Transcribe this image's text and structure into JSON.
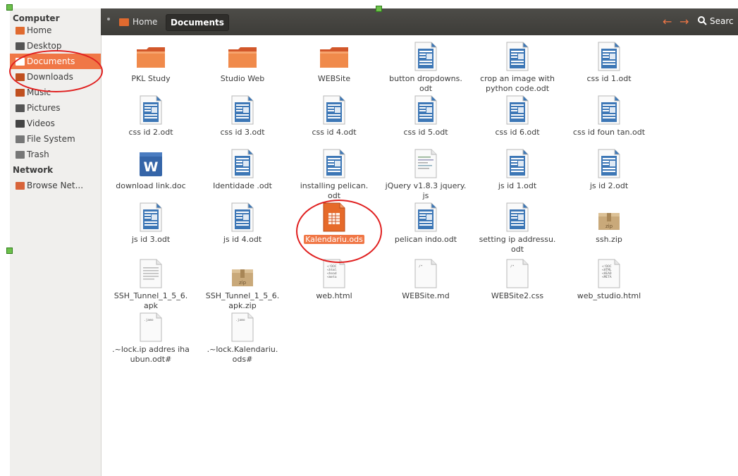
{
  "sidebar": {
    "computer_heading": "Computer",
    "items": [
      {
        "label": "Home",
        "color": "#e06a2f"
      },
      {
        "label": "Desktop",
        "color": "#555"
      },
      {
        "label": "Documents",
        "color": "#ffffff"
      },
      {
        "label": "Downloads",
        "color": "#c05020"
      },
      {
        "label": "Music",
        "color": "#c05020"
      },
      {
        "label": "Pictures",
        "color": "#555"
      },
      {
        "label": "Videos",
        "color": "#444"
      },
      {
        "label": "File System",
        "color": "#777"
      },
      {
        "label": "Trash",
        "color": "#777"
      }
    ],
    "network_heading": "Network",
    "network_items": [
      {
        "label": "Browse Net..."
      }
    ]
  },
  "breadcrumb": {
    "home": "Home",
    "current": "Documents"
  },
  "search_text": "Searc",
  "files": [
    {
      "name": "PKL Study",
      "type": "folder"
    },
    {
      "name": "Studio Web",
      "type": "folder"
    },
    {
      "name": "WEBSite",
      "type": "folder"
    },
    {
      "name": "button dropdowns.\nodt",
      "type": "odt"
    },
    {
      "name": "crop an image with\npython code.odt",
      "type": "odt"
    },
    {
      "name": "css id 1.odt",
      "type": "odt"
    },
    {
      "name": "css id 2.odt",
      "type": "odt"
    },
    {
      "name": "css id 3.odt",
      "type": "odt"
    },
    {
      "name": "css id 4.odt",
      "type": "odt"
    },
    {
      "name": "css id 5.odt",
      "type": "odt"
    },
    {
      "name": "css id 6.odt",
      "type": "odt"
    },
    {
      "name": "css id foun tan.odt",
      "type": "odt"
    },
    {
      "name": "download link.doc",
      "type": "doc"
    },
    {
      "name": "Identidade .odt",
      "type": "odt"
    },
    {
      "name": "installing pelican.\nodt",
      "type": "odt"
    },
    {
      "name": "jQuery v1.8.3 jquery.\njs",
      "type": "js"
    },
    {
      "name": "js id 1.odt",
      "type": "odt"
    },
    {
      "name": "js id 2.odt",
      "type": "odt"
    },
    {
      "name": "js id 3.odt",
      "type": "odt"
    },
    {
      "name": "js id 4.odt",
      "type": "odt"
    },
    {
      "name": "Kalendariu.ods",
      "type": "ods",
      "selected": true
    },
    {
      "name": "pelican indo.odt",
      "type": "odt"
    },
    {
      "name": "setting ip addressu.\nodt",
      "type": "odt"
    },
    {
      "name": "ssh.zip",
      "type": "zip"
    },
    {
      "name": "SSH_Tunnel_1_5_6.\napk",
      "type": "apk"
    },
    {
      "name": "SSH_Tunnel_1_5_6.\napk.zip",
      "type": "zip"
    },
    {
      "name": "web.html",
      "type": "html",
      "thumb": "<!DOC\n<html\n<head\n<meta"
    },
    {
      "name": "WEBSite.md",
      "type": "text",
      "thumb": "/*"
    },
    {
      "name": "WEBSite2.css",
      "type": "text",
      "thumb": "/*"
    },
    {
      "name": "web_studio.html",
      "type": "html",
      "thumb": "<!DOC\n<HTML\n<HEAD\n<META"
    },
    {
      "name": ".~lock.ip addres iha\nubun.odt#",
      "type": "lock",
      "thumb": ".jamo"
    },
    {
      "name": ".~lock.Kalendariu.\nods#",
      "type": "lock",
      "thumb": ".jamo"
    }
  ],
  "colors": {
    "accent": "#f07746",
    "annotation": "#e02020"
  }
}
